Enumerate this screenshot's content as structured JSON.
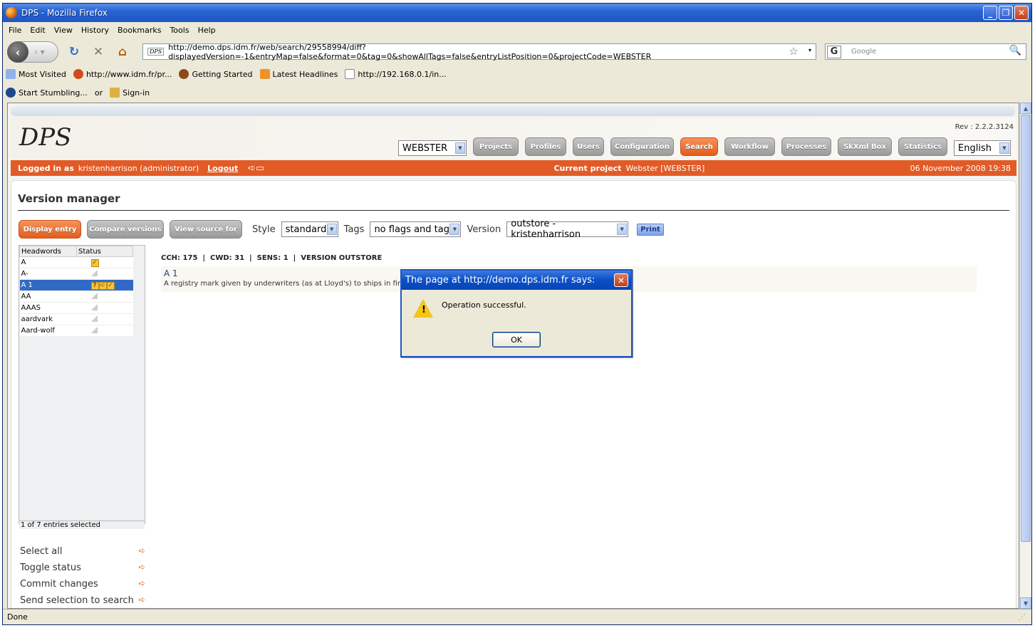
{
  "window": {
    "title": "DPS - Mozilla Firefox"
  },
  "menu": [
    "File",
    "Edit",
    "View",
    "History",
    "Bookmarks",
    "Tools",
    "Help"
  ],
  "nav": {
    "url": "http://demo.dps.idm.fr/web/search/29558994/diff?displayedVersion=-1&entryMap=false&format=0&tag=0&showAllTags=false&entryListPosition=0&projectCode=WEBSTER",
    "favicon": "DPS",
    "search_placeholder": "Google"
  },
  "bookmarks": [
    "Most Visited",
    "http://www.idm.fr/pr...",
    "Getting Started",
    "Latest Headlines",
    "http://192.168.0.1/in..."
  ],
  "stumble": {
    "start": "Start Stumbling...",
    "or": "or",
    "signin": "Sign-in"
  },
  "app": {
    "logo": "DPS",
    "rev": "Rev : 2.2.2.3124",
    "project_select": "WEBSTER",
    "tabs": [
      {
        "label": "Projects",
        "w": 64
      },
      {
        "label": "Profiles",
        "w": 58
      },
      {
        "label": "Users",
        "w": 44
      },
      {
        "label": "Configuration",
        "w": 89
      },
      {
        "label": "Search",
        "w": 53
      },
      {
        "label": "Workflow",
        "w": 71
      },
      {
        "label": "Processes",
        "w": 70
      },
      {
        "label": "SkXml Box",
        "w": 76
      },
      {
        "label": "Statistics",
        "w": 69
      }
    ],
    "language": "English",
    "logged_in_label": "Logged in as",
    "user": "kristenharrison (administrator)",
    "logout": "Logout",
    "current_project_label": "Current project",
    "current_project": "Webster [WEBSTER]",
    "date": "06 November 2008 19:38"
  },
  "version_manager": {
    "title": "Version manager",
    "buttons": {
      "display": "Display entry",
      "compare": "Compare versions",
      "source": "View source for"
    },
    "style_label": "Style",
    "style_value": "standard",
    "tags_label": "Tags",
    "tags_value": "no flags and tags",
    "version_label": "Version",
    "version_value": "outstore - kristenharrison",
    "print": "Print",
    "columns": {
      "headword": "Headwords",
      "status": "Status"
    },
    "entries": [
      "A",
      "A-",
      "A 1",
      "AA",
      "AAAS",
      "aardvark",
      "Aard-wolf"
    ],
    "count": "1 of 7 entries selected",
    "actions": [
      "Select all",
      "Toggle status",
      "Commit changes",
      "Send selection to search"
    ],
    "entry_header": "CCH: 175  |  CWD: 31  |  SENS: 1  |  VERSION OUTSTORE",
    "entry_headword": "A 1",
    "entry_definition": "A registry mark given by underwriters (as at Lloyd's) to ships in first-c"
  },
  "dialog": {
    "title": "The page at http://demo.dps.idm.fr says:",
    "message": "Operation successful.",
    "ok": "OK"
  },
  "status": "Done"
}
